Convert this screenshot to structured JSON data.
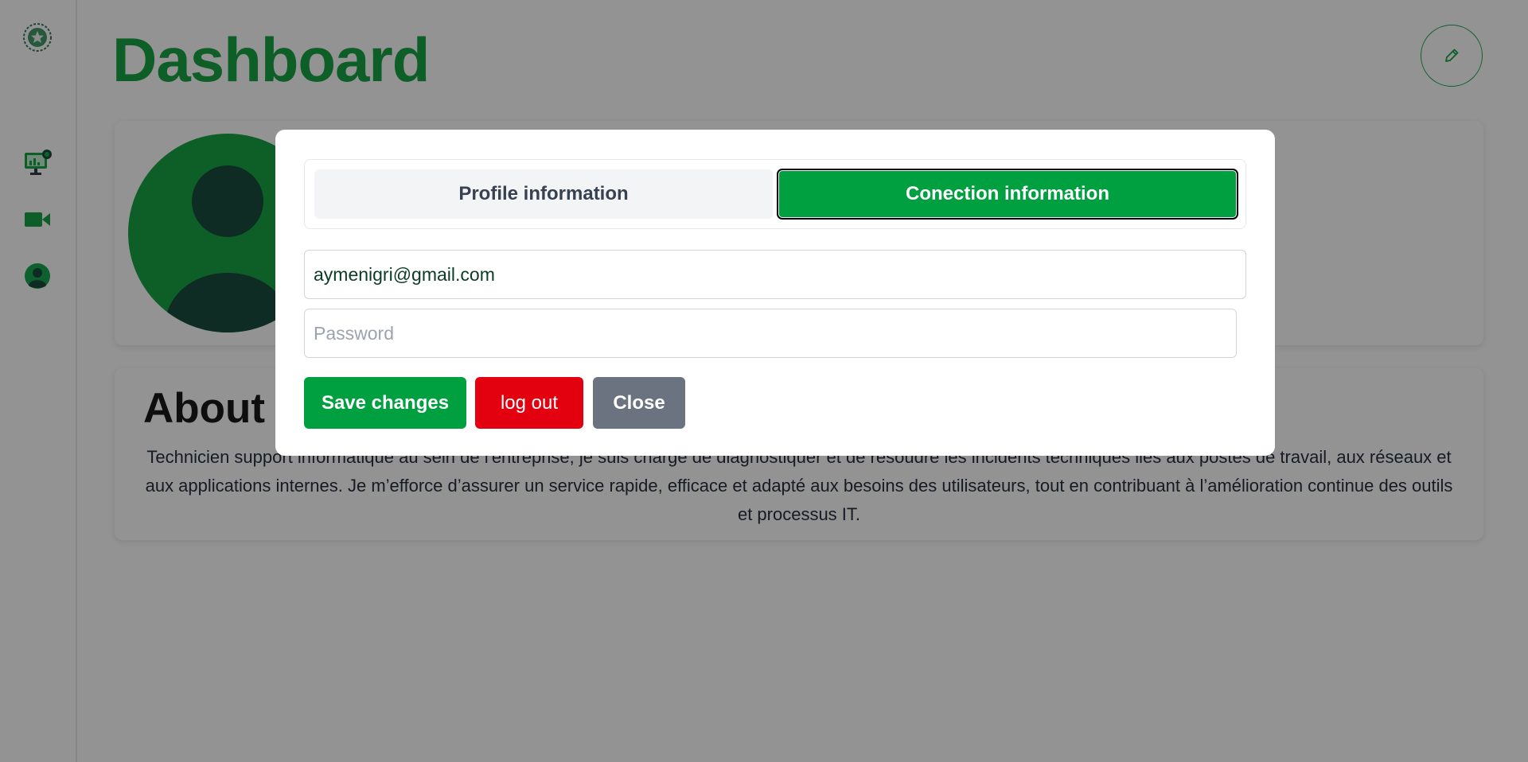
{
  "header": {
    "title": "Dashboard"
  },
  "about": {
    "title": "About",
    "text": "Technicien support informatique au sein de l'entreprise, je suis chargé de diagnostiquer et de résoudre les incidents techniques liés aux postes de travail, aux réseaux et aux applications internes. Je m’efforce d’assurer un service rapide, efficace et adapté aux besoins des utilisateurs, tout en contribuant à l’amélioration continue des outils et processus IT."
  },
  "sidebar": {
    "items": [
      {
        "icon": "logo-star-emblem-icon"
      },
      {
        "icon": "monitor-chart-icon"
      },
      {
        "icon": "video-camera-icon"
      },
      {
        "icon": "user-profile-icon"
      }
    ]
  },
  "modal": {
    "tabs": [
      {
        "label": "Profile information",
        "active": false
      },
      {
        "label": "Conection information",
        "active": true
      }
    ],
    "email": {
      "value": "aymenigri@gmail.com"
    },
    "password": {
      "value": "",
      "placeholder": "Password"
    },
    "buttons": {
      "save": "Save changes",
      "logout": "log out",
      "close": "Close"
    }
  },
  "colors": {
    "brand_green": "#00a040",
    "title_green": "#009933",
    "danger_red": "#e3000f",
    "neutral_gray": "#6b7280",
    "avatar_dark": "#003a2a"
  }
}
